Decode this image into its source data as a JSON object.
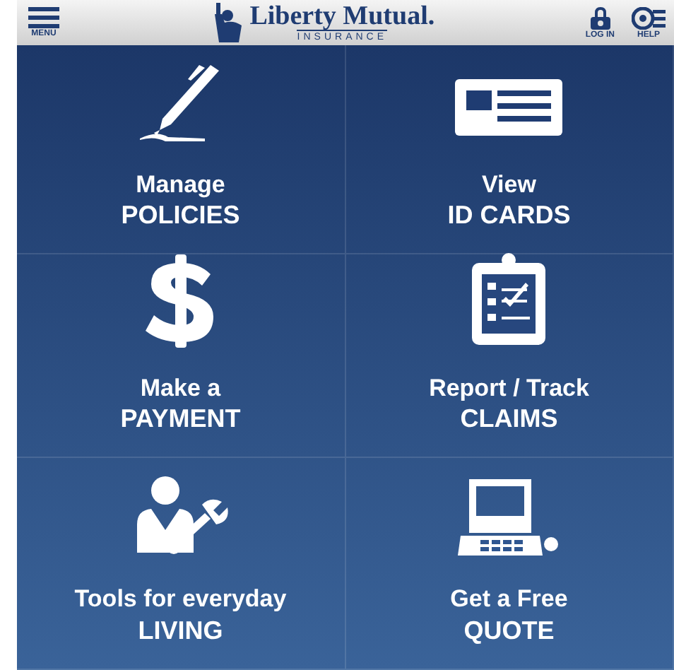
{
  "header": {
    "menu_label": "MENU",
    "logo_name": "Liberty Mutual.",
    "logo_tagline": "INSURANCE",
    "login_label": "LOG IN",
    "help_label": "HELP"
  },
  "tiles": [
    {
      "line_1": "Manage",
      "line_2": "POLICIES"
    },
    {
      "line_1": "View",
      "line_2": "ID CARDS"
    },
    {
      "line_1": "Make a",
      "line_2": "PAYMENT"
    },
    {
      "line_1": "Report / Track",
      "line_2": "CLAIMS"
    },
    {
      "line_1": "Tools for everyday",
      "line_2": "LIVING"
    },
    {
      "line_1": "Get a Free",
      "line_2": "QUOTE"
    }
  ]
}
